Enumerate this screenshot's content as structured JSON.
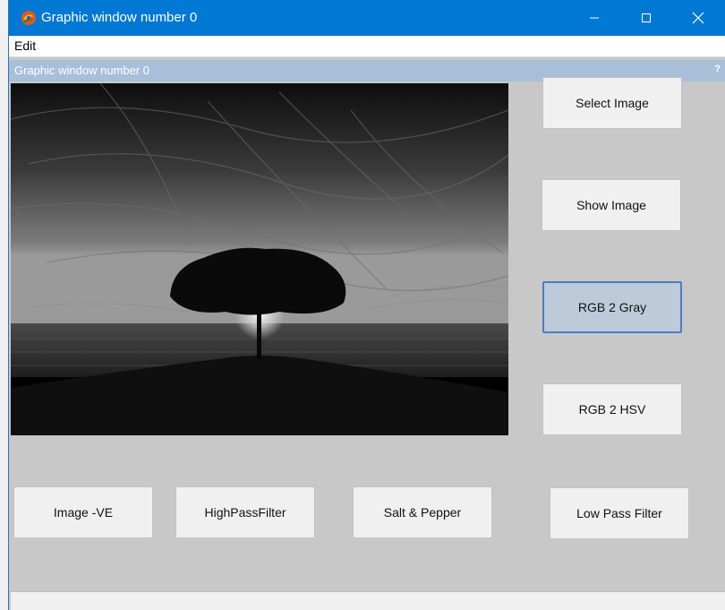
{
  "window": {
    "title": "Graphic window number 0",
    "subtitle": "Graphic window number 0",
    "help_icon": "?"
  },
  "menu": {
    "edit": "Edit"
  },
  "buttons": {
    "select_image": "Select Image",
    "show_image": "Show Image",
    "rgb2gray": "RGB 2 Gray",
    "rgb2hsv": "RGB 2 HSV",
    "image_ve": "Image -VE",
    "highpass": "HighPassFilter",
    "salt_pepper": "Salt & Pepper",
    "lowpass": "Low Pass Filter"
  },
  "icons": {
    "app": "scilab-app-icon",
    "minimize": "minimize-icon",
    "maximize": "maximize-icon",
    "close": "close-icon",
    "help": "help-icon"
  },
  "colors": {
    "titlebar": "#0078d4",
    "subtitlebar": "#a7bfd9",
    "canvas": "#c8c8c8",
    "active_button": "#bccad9"
  }
}
